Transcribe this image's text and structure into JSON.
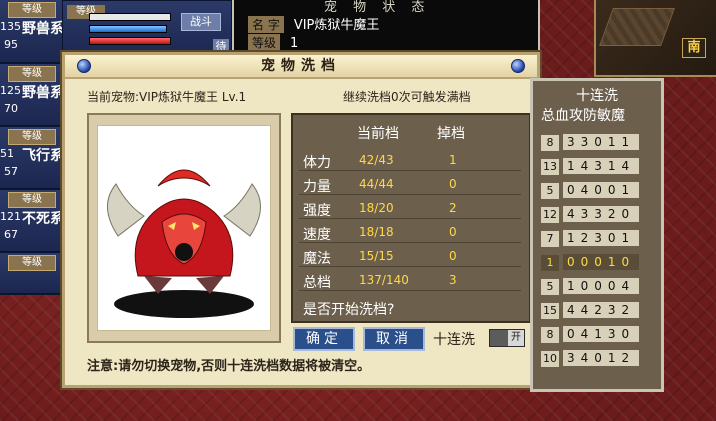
{
  "pet_list": [
    {
      "lvl_tag": "等级",
      "lvl": "135",
      "name": "野兽系",
      "sub": "95"
    },
    {
      "lvl_tag": "等级",
      "lvl": "125",
      "name": "野兽系",
      "sub": "70"
    },
    {
      "lvl_tag": "等级",
      "lvl": "51",
      "name": "飞行系",
      "sub": "57"
    },
    {
      "lvl_tag": "等级",
      "lvl": "121",
      "name": "不死系",
      "sub": "67"
    },
    {
      "lvl_tag": "等级",
      "lvl": "",
      "name": "",
      "sub": ""
    }
  ],
  "status_bar": {
    "lvl_tag": "等级",
    "lvl": "1",
    "fight": "战斗",
    "wait": "待"
  },
  "pet_status": {
    "title": "宠 物 状 态",
    "name_label": "名 字",
    "name": "VIP炼狱牛魔王",
    "lvl_label": "等级",
    "lvl": "1"
  },
  "map": {
    "direction": "南"
  },
  "dialog": {
    "title": "宠物洗档",
    "current_pet": "当前宠物:VIP炼狱牛魔王 Lv.1",
    "tip": "继续洗档0次可触发满档",
    "stats_header_cur": "当前档",
    "stats_header_drop": "掉档",
    "stats": [
      {
        "label": "体力",
        "cur": "42/43",
        "drop": "1"
      },
      {
        "label": "力量",
        "cur": "44/44",
        "drop": "0"
      },
      {
        "label": "强度",
        "cur": "18/20",
        "drop": "2"
      },
      {
        "label": "速度",
        "cur": "18/18",
        "drop": "0"
      },
      {
        "label": "魔法",
        "cur": "15/15",
        "drop": "0"
      },
      {
        "label": "总档",
        "cur": "137/140",
        "drop": "3"
      }
    ],
    "question": "是否开始洗档?",
    "confirm": "确定",
    "cancel": "取消",
    "ten_label": "十连洗",
    "toggle": "开",
    "notice": "注意:请勿切换宠物,否则十连洗档数据将被清空。"
  },
  "ten_panel": {
    "title": "十连洗",
    "header": "总血攻防敏魔",
    "rows": [
      {
        "total": "8",
        "vals": "33011"
      },
      {
        "total": "13",
        "vals": "14314"
      },
      {
        "total": "5",
        "vals": "04001"
      },
      {
        "total": "12",
        "vals": "43320"
      },
      {
        "total": "7",
        "vals": "12301"
      },
      {
        "total": "1",
        "vals": "00010"
      },
      {
        "total": "5",
        "vals": "10004"
      },
      {
        "total": "15",
        "vals": "44232"
      },
      {
        "total": "8",
        "vals": "04130"
      },
      {
        "total": "10",
        "vals": "34012"
      }
    ]
  }
}
